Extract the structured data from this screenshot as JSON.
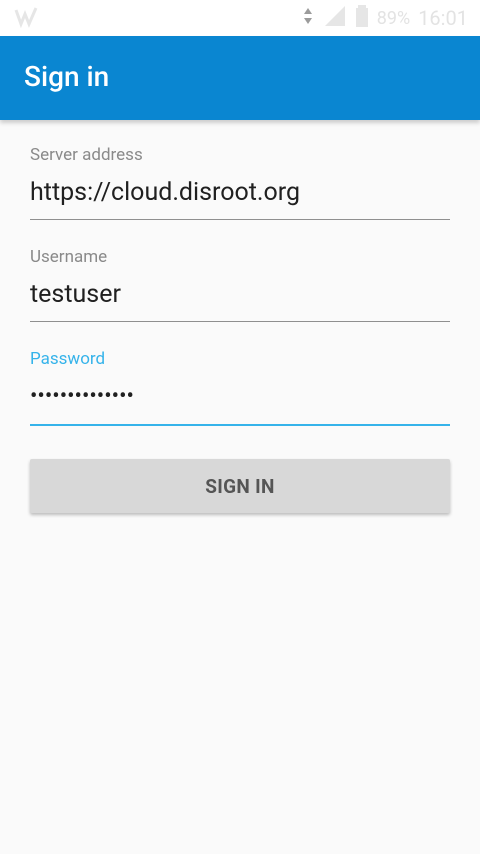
{
  "status_bar": {
    "battery": "89%",
    "time": "16:01"
  },
  "app_bar": {
    "title": "Sign in"
  },
  "form": {
    "server": {
      "label": "Server address",
      "value": "https://cloud.disroot.org"
    },
    "username": {
      "label": "Username",
      "value": "testuser"
    },
    "password": {
      "label": "Password",
      "value": "••••••••••••••"
    }
  },
  "button": {
    "label": "SIGN IN"
  },
  "colors": {
    "app_bar": "#0a86d1",
    "focus_accent": "#35b3ea",
    "button_bg": "#d8d8d8"
  }
}
